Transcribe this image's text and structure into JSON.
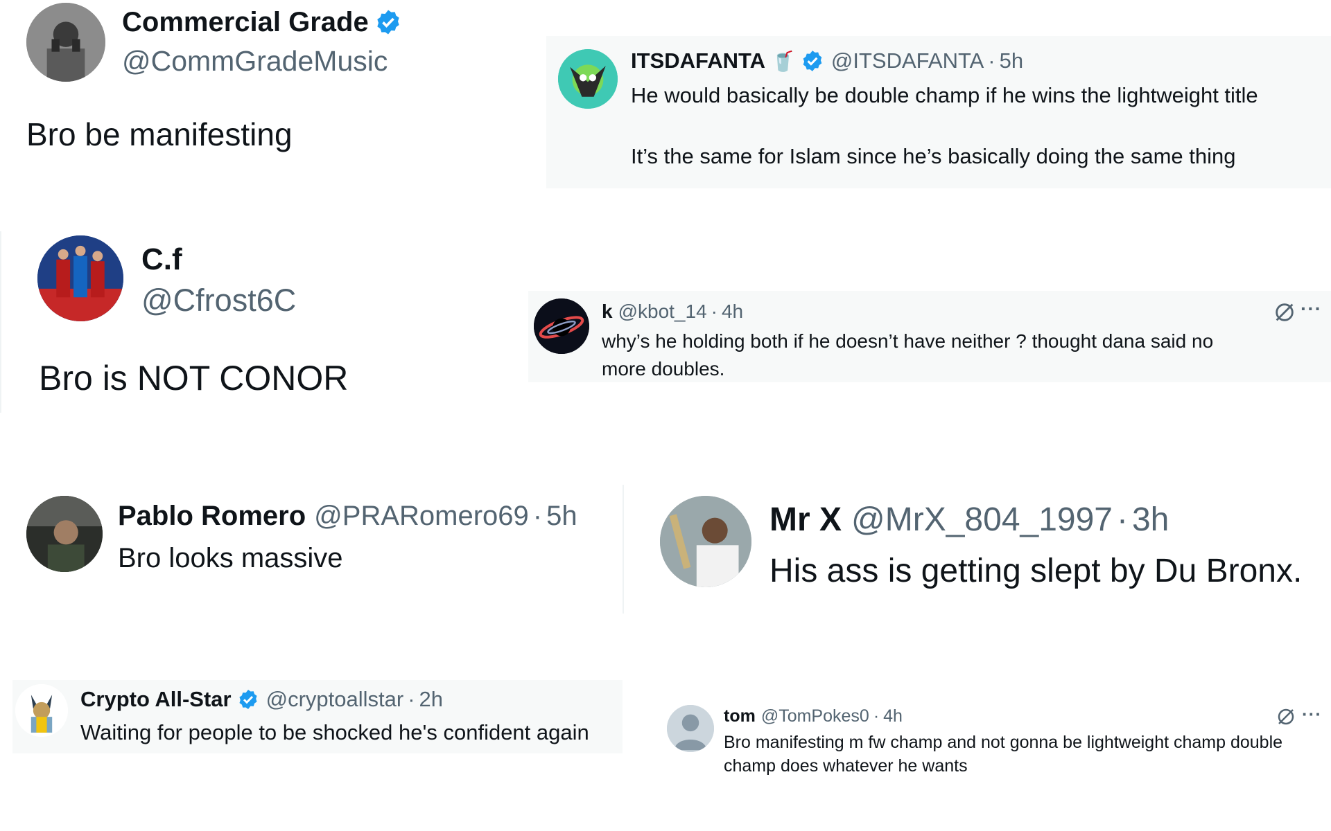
{
  "tweets": {
    "commgrade": {
      "name": "Commercial Grade",
      "handle": "@CommGradeMusic",
      "text": "Bro be manifesting"
    },
    "itsdafanta": {
      "name": "ITSDAFANTA",
      "emoji": "🥤",
      "handle": "@ITSDAFANTA",
      "time": "5h",
      "line1": "He would basically be double champ if he wins the lightweight title",
      "line2": "It’s the same for Islam since he’s basically doing the same thing"
    },
    "cf": {
      "name": "C.f",
      "handle": "@Cfrost6C",
      "text": "Bro is NOT CONOR"
    },
    "kbot": {
      "name": "k",
      "handle": "@kbot_14",
      "time": "4h",
      "line1": "why’s he holding both if he doesn’t have neither ? thought dana said no",
      "line2": "more doubles.",
      "more": "···"
    },
    "pablo": {
      "name": "Pablo Romero",
      "handle": "@PRARomero69",
      "time": "5h",
      "text": "Bro looks massive"
    },
    "mrx": {
      "name": "Mr X",
      "handle": "@MrX_804_1997",
      "time": "3h",
      "text": "His ass is getting slept by Du Bronx."
    },
    "crypto": {
      "name": "Crypto All-Star",
      "handle": "@cryptoallstar",
      "time": "2h",
      "text": "Waiting for people to be shocked he's confident again"
    },
    "tom": {
      "name": "tom",
      "handle": "@TomPokes0",
      "time": "4h",
      "line1": "Bro manifesting m fw champ and not gonna be lightweight champ double",
      "line2": "champ does whatever he wants",
      "more": "···"
    }
  },
  "separator": "·",
  "colors": {
    "verified": "#1d9bf0",
    "handle": "#536471",
    "text": "#0f1419",
    "card_bg": "#f7f9f9"
  },
  "icons": {
    "verified": "verified-badge-icon",
    "grok": "grok-icon",
    "more": "more-icon"
  }
}
